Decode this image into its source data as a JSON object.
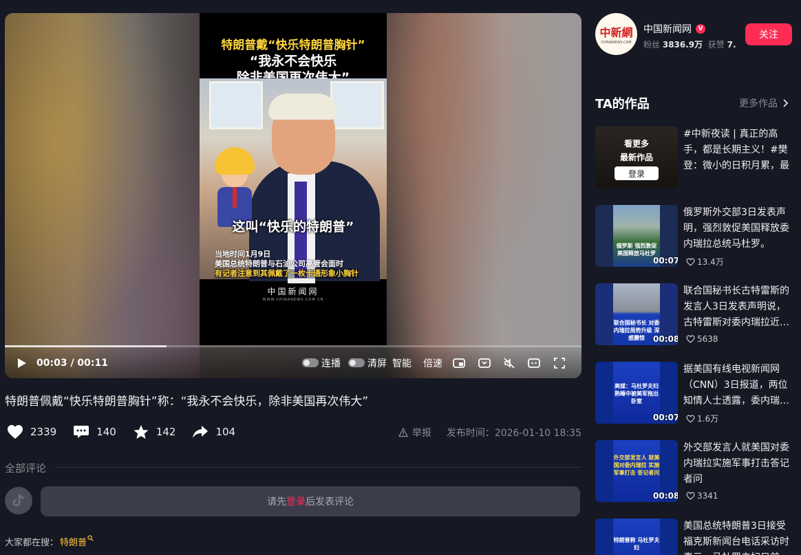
{
  "player": {
    "frame": {
      "headline_1": "特朗普戴“快乐特朗普胸针”",
      "headline_2": "“我永不会快乐",
      "headline_3": "除非美国再次伟大”",
      "overlay": "这叫“快乐的特朗普”",
      "caption_1": "当地时间1月9日",
      "caption_2": "美国总统特朗普与石油公司高管会面时",
      "caption_3": "有记者注意到其佩戴了一枚卡通形象小胸针",
      "logo": "中国新闻网",
      "logo_sub": "WWW.CHINANEWS.COM.CN"
    },
    "progress": 0.28,
    "time": "00:03 / 00:11",
    "continuous_label": "连播",
    "clear_label": "清屏",
    "smart_label": "智能",
    "speed_label": "倍速"
  },
  "video": {
    "title": "特朗普佩戴“快乐特朗普胸针”称：“我永不会快乐，除非美国再次伟大”",
    "likes": "2339",
    "comments": "140",
    "favorites": "142",
    "shares": "104",
    "report": "举报",
    "publish": "发布时间：2026-01-10 18:35"
  },
  "comments_section": {
    "header": "全部评论",
    "prompt_before": "请先",
    "prompt_login": "登录",
    "prompt_after": "后发表评论"
  },
  "hot_search": {
    "label": "大家都在搜：",
    "keyword": "特朗普"
  },
  "author": {
    "avatar_text": "中新網",
    "avatar_sub": "CHINANEWS.COM",
    "name": "中国新闻网",
    "verified": "V",
    "fans_label": "粉丝",
    "fans": "3836.9万",
    "likes_label": "获赞",
    "likes": "7.…",
    "follow": "关注"
  },
  "works": {
    "title": "TA的作品",
    "more": "更多作品",
    "login_card": {
      "line1": "看更多",
      "line2": "最新作品",
      "button": "登录"
    },
    "items": [
      {
        "title": "#中新夜读 | 真正的高手，都是长期主义！#樊登：微小的日积月累，最终…"
      },
      {
        "title": "俄罗斯外交部3日发表声明，强烈敦促美国释放委内瑞拉总统马杜罗。",
        "duration": "00:07",
        "likes": "13.4万",
        "thumb_text": "俄罗斯 强烈敦促 美国释放马杜罗"
      },
      {
        "title": "联合国秘书长古特雷斯的发言人3日发表声明说，古特雷斯对委内瑞拉近…",
        "duration": "00:08",
        "likes": "5638",
        "thumb_text": "联合国秘书长 对委内瑞拉局势升级 深感震惊"
      },
      {
        "title": "据美国有线电视新闻网（CNN）3日报道，两位知情人士透露，委内瑞…",
        "duration": "00:07",
        "likes": "1.6万",
        "thumb_text": "美媒：马杜罗夫妇熟睡中被美军拖出卧室"
      },
      {
        "title": "外交部发言人就美国对委内瑞拉实施军事打击答记者问",
        "duration": "00:08",
        "likes": "3341",
        "thumb_text": "外交部发言人 就美国对委内瑞拉 实施军事打击 答记者问"
      },
      {
        "title": "美国总统特朗普3日接受福克斯新闻台电话采访时表示，马杜罗夫妇目前…",
        "thumb_text": "特朗普称 马杜罗夫妇"
      }
    ]
  },
  "colors": {
    "accent": "#fe2c55",
    "background": "#161823",
    "keyword": "#ffc43d"
  }
}
